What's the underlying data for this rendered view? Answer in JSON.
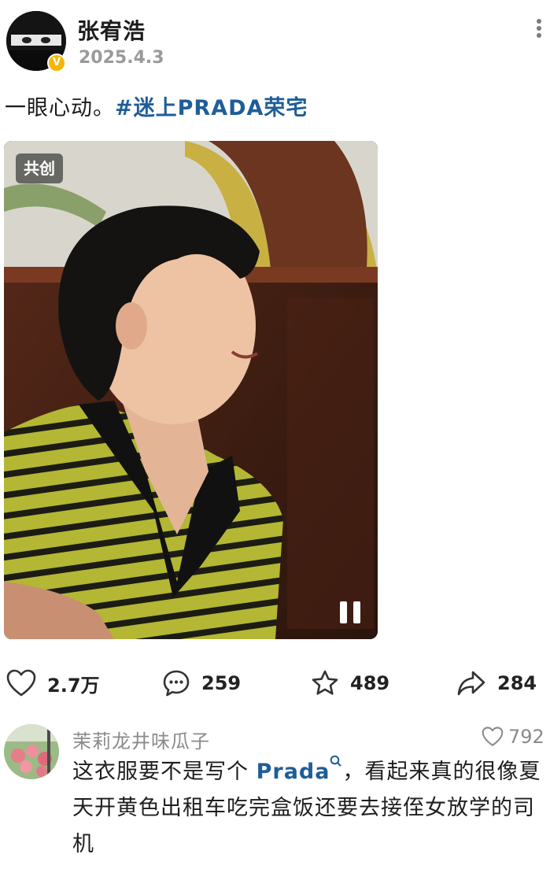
{
  "post": {
    "author": "张宥浩",
    "date": "2025.4.3",
    "text": "一眼心动。",
    "hashtag": "#迷上PRADA荣宅",
    "media_badge": "共创"
  },
  "actions": {
    "like_count": "2.7万",
    "comment_count": "259",
    "favorite_count": "489",
    "share_count": "284"
  },
  "comment": {
    "user": "茉莉龙井味瓜子",
    "like_count": "792",
    "text_before": "这衣服要不是写个 ",
    "link_text": "Prada",
    "text_after": "，看起来真的很像夏天开黄色出租车吃完盒饭还要去接侄女放学的司机"
  },
  "colors": {
    "link": "#1f5d99",
    "verified_badge": "#f7b500",
    "shirt_yellow": "#b3b733",
    "muted_text": "#8a8a8a"
  },
  "icons": [
    "more-icon",
    "verified-icon",
    "pause-icon",
    "heart-icon",
    "comment-icon",
    "star-icon",
    "share-icon",
    "search-icon"
  ]
}
